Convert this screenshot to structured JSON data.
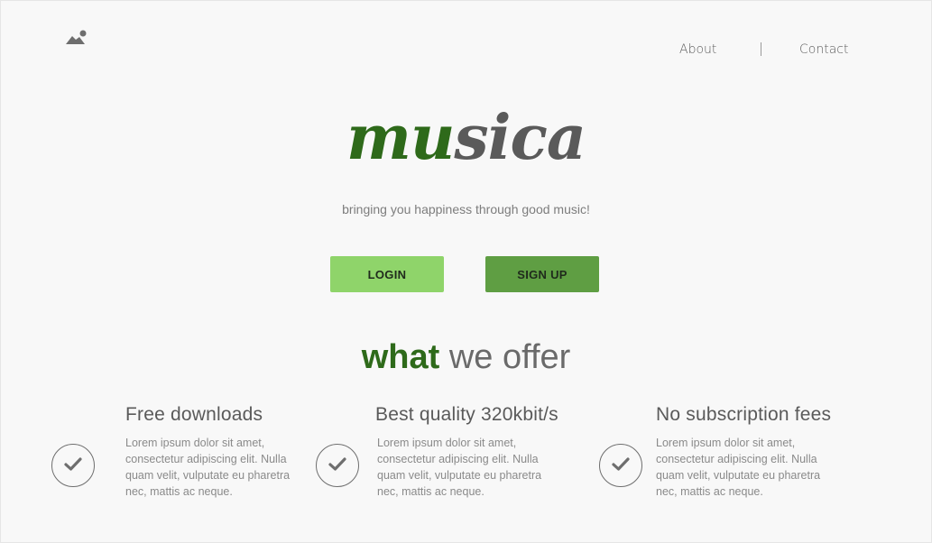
{
  "header": {
    "logo_icon": "mountain-sun-icon",
    "nav": {
      "about_label": "About",
      "contact_label": "Contact"
    }
  },
  "hero": {
    "brand_accent": "mu",
    "brand_rest": "sica",
    "tagline": "bringing you happiness through good music!",
    "login_label": "LOGIN",
    "signup_label": "SIGN UP"
  },
  "offer": {
    "heading_accent": "what",
    "heading_rest": "we offer",
    "features": [
      {
        "icon": "checkmark-icon",
        "title": "Free downloads",
        "body": "Lorem ipsum dolor sit amet, consectetur adipiscing elit. Nulla quam velit, vulputate eu pharetra nec, mattis ac neque."
      },
      {
        "icon": "checkmark-icon",
        "title": "Best quality 320kbit/s",
        "body": "Lorem ipsum dolor sit amet, consectetur adipiscing elit. Nulla quam velit, vulputate eu pharetra nec, mattis ac neque."
      },
      {
        "icon": "checkmark-icon",
        "title": "No subscription fees",
        "body": "Lorem ipsum dolor sit amet, consectetur adipiscing elit. Nulla quam velit, vulputate eu pharetra nec, mattis ac neque."
      }
    ]
  },
  "colors": {
    "brand_green_dark": "#2e6a1a",
    "login_green": "#8fd46a",
    "signup_green": "#5f9e43",
    "text_gray": "#5a5a5a",
    "background": "#f8f8f8"
  }
}
